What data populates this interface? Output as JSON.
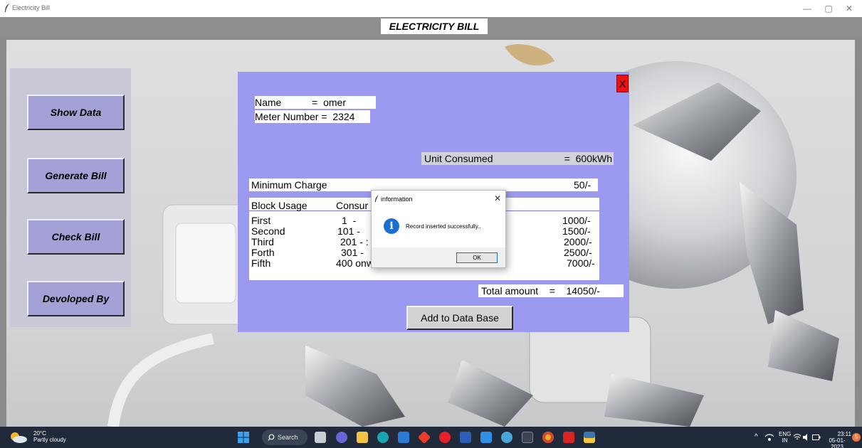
{
  "window": {
    "title": "Electricity Bill",
    "controls": {
      "minimize": "—",
      "maximize": "▢",
      "close": "✕"
    }
  },
  "header": {
    "label": "ELECTRICITY BILL"
  },
  "menu": {
    "show_data": "Show Data",
    "generate_bill": "Generate Bill",
    "check_bill": "Check Bill",
    "developed_by": "Devoloped By"
  },
  "bill": {
    "close_label": "X",
    "name_label": "Name           =  omer",
    "meter_label": "Meter Number =  2324",
    "unit_label": "Unit Consumed",
    "unit_value": "=  600kWh",
    "min_charge_label": "Minimum Charge",
    "min_charge_value": "50/-",
    "block_usage_label": "Block Usage",
    "consumed_label": "Consur",
    "rows": [
      {
        "name": "First",
        "range": "1  -",
        "units": "",
        "amount": "1000/-"
      },
      {
        "name": "Second",
        "range": "101 -",
        "units": "",
        "amount": "1500/-"
      },
      {
        "name": "Third",
        "range": "201 - :",
        "units": "",
        "amount": "2000/-"
      },
      {
        "name": "Forth",
        "range": "301 - ",
        "units": "",
        "amount": "2500/-"
      },
      {
        "name": "Fifth",
        "range": "400 onwards",
        "units": "35",
        "amount": "7000/-"
      }
    ],
    "total_label": "Total amount    =    14050/-",
    "add_button": "Add to Data Base"
  },
  "dialog": {
    "title": "information",
    "close": "✕",
    "icon_glyph": "i",
    "message": "Record inserted successfully..",
    "ok": "OK"
  },
  "taskbar": {
    "weather_temp": "20°C",
    "weather_desc": "Partly cloudy",
    "search_label": "Search",
    "language": "ENG",
    "region": "IN",
    "time": "23:11",
    "date": "05-01-2023",
    "notification_count": "5"
  },
  "colors": {
    "panel": "#9b9af0",
    "menu_button": "#a3a1d6",
    "header_bar": "#8e8e8e",
    "taskbar": "#202a3a",
    "close_red": "#ee1111",
    "info_blue": "#1b6fd0"
  }
}
